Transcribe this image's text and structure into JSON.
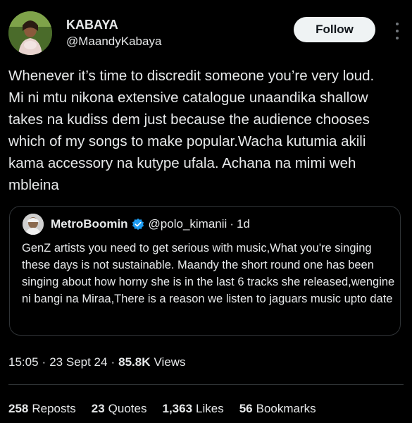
{
  "author": {
    "display_name": "KABAYA",
    "handle": "@MaandyKabaya",
    "follow_label": "Follow"
  },
  "tweet": {
    "text": "Whenever it’s time to discredit someone you’re very loud. Mi ni mtu nikona extensive catalogue unaandika shallow takes na kudiss dem just because the audience chooses which of my songs to make popular.Wacha kutumia akili kama accessory na kutype ufala. Achana na mimi weh mbleina"
  },
  "quote": {
    "display_name": "MetroBoomin",
    "handle": "@polo_kimanii",
    "dot": "·",
    "time": "1d",
    "text": "GenZ artists you need to get serious with music,What you're singing these days is not sustainable. Maandy the short round one has been singing about how horny she is in the last 6 tracks she released,wengine ni bangi na Miraa,There is a reason we listen to jaguars music upto date"
  },
  "meta": {
    "time": "15:05",
    "sep": "·",
    "date": "23 Sept 24",
    "views_count": "85.8K",
    "views_label": "Views"
  },
  "stats": [
    {
      "count": "258",
      "label": "Reposts"
    },
    {
      "count": "23",
      "label": "Quotes"
    },
    {
      "count": "1,363",
      "label": "Likes"
    },
    {
      "count": "56",
      "label": "Bookmarks"
    }
  ],
  "icons": {
    "verified_color": "#1d9bf0",
    "more": "more-options-icon"
  }
}
